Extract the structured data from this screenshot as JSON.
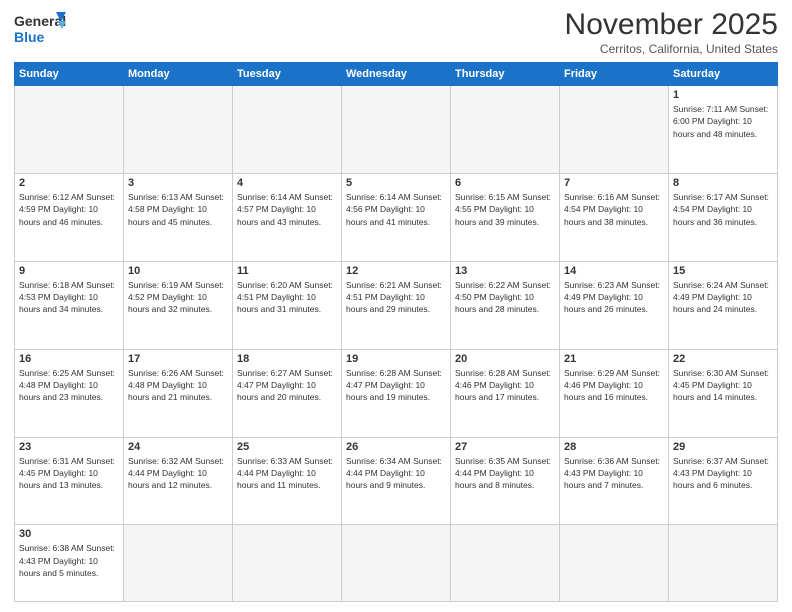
{
  "header": {
    "logo_general": "General",
    "logo_blue": "Blue",
    "month_title": "November 2025",
    "location": "Cerritos, California, United States"
  },
  "days_of_week": [
    "Sunday",
    "Monday",
    "Tuesday",
    "Wednesday",
    "Thursday",
    "Friday",
    "Saturday"
  ],
  "weeks": [
    [
      {
        "day": "",
        "info": ""
      },
      {
        "day": "",
        "info": ""
      },
      {
        "day": "",
        "info": ""
      },
      {
        "day": "",
        "info": ""
      },
      {
        "day": "",
        "info": ""
      },
      {
        "day": "",
        "info": ""
      },
      {
        "day": "1",
        "info": "Sunrise: 7:11 AM\nSunset: 6:00 PM\nDaylight: 10 hours and 48 minutes."
      }
    ],
    [
      {
        "day": "2",
        "info": "Sunrise: 6:12 AM\nSunset: 4:59 PM\nDaylight: 10 hours and 46 minutes."
      },
      {
        "day": "3",
        "info": "Sunrise: 6:13 AM\nSunset: 4:58 PM\nDaylight: 10 hours and 45 minutes."
      },
      {
        "day": "4",
        "info": "Sunrise: 6:14 AM\nSunset: 4:57 PM\nDaylight: 10 hours and 43 minutes."
      },
      {
        "day": "5",
        "info": "Sunrise: 6:14 AM\nSunset: 4:56 PM\nDaylight: 10 hours and 41 minutes."
      },
      {
        "day": "6",
        "info": "Sunrise: 6:15 AM\nSunset: 4:55 PM\nDaylight: 10 hours and 39 minutes."
      },
      {
        "day": "7",
        "info": "Sunrise: 6:16 AM\nSunset: 4:54 PM\nDaylight: 10 hours and 38 minutes."
      },
      {
        "day": "8",
        "info": "Sunrise: 6:17 AM\nSunset: 4:54 PM\nDaylight: 10 hours and 36 minutes."
      }
    ],
    [
      {
        "day": "9",
        "info": "Sunrise: 6:18 AM\nSunset: 4:53 PM\nDaylight: 10 hours and 34 minutes."
      },
      {
        "day": "10",
        "info": "Sunrise: 6:19 AM\nSunset: 4:52 PM\nDaylight: 10 hours and 32 minutes."
      },
      {
        "day": "11",
        "info": "Sunrise: 6:20 AM\nSunset: 4:51 PM\nDaylight: 10 hours and 31 minutes."
      },
      {
        "day": "12",
        "info": "Sunrise: 6:21 AM\nSunset: 4:51 PM\nDaylight: 10 hours and 29 minutes."
      },
      {
        "day": "13",
        "info": "Sunrise: 6:22 AM\nSunset: 4:50 PM\nDaylight: 10 hours and 28 minutes."
      },
      {
        "day": "14",
        "info": "Sunrise: 6:23 AM\nSunset: 4:49 PM\nDaylight: 10 hours and 26 minutes."
      },
      {
        "day": "15",
        "info": "Sunrise: 6:24 AM\nSunset: 4:49 PM\nDaylight: 10 hours and 24 minutes."
      }
    ],
    [
      {
        "day": "16",
        "info": "Sunrise: 6:25 AM\nSunset: 4:48 PM\nDaylight: 10 hours and 23 minutes."
      },
      {
        "day": "17",
        "info": "Sunrise: 6:26 AM\nSunset: 4:48 PM\nDaylight: 10 hours and 21 minutes."
      },
      {
        "day": "18",
        "info": "Sunrise: 6:27 AM\nSunset: 4:47 PM\nDaylight: 10 hours and 20 minutes."
      },
      {
        "day": "19",
        "info": "Sunrise: 6:28 AM\nSunset: 4:47 PM\nDaylight: 10 hours and 19 minutes."
      },
      {
        "day": "20",
        "info": "Sunrise: 6:28 AM\nSunset: 4:46 PM\nDaylight: 10 hours and 17 minutes."
      },
      {
        "day": "21",
        "info": "Sunrise: 6:29 AM\nSunset: 4:46 PM\nDaylight: 10 hours and 16 minutes."
      },
      {
        "day": "22",
        "info": "Sunrise: 6:30 AM\nSunset: 4:45 PM\nDaylight: 10 hours and 14 minutes."
      }
    ],
    [
      {
        "day": "23",
        "info": "Sunrise: 6:31 AM\nSunset: 4:45 PM\nDaylight: 10 hours and 13 minutes."
      },
      {
        "day": "24",
        "info": "Sunrise: 6:32 AM\nSunset: 4:44 PM\nDaylight: 10 hours and 12 minutes."
      },
      {
        "day": "25",
        "info": "Sunrise: 6:33 AM\nSunset: 4:44 PM\nDaylight: 10 hours and 11 minutes."
      },
      {
        "day": "26",
        "info": "Sunrise: 6:34 AM\nSunset: 4:44 PM\nDaylight: 10 hours and 9 minutes."
      },
      {
        "day": "27",
        "info": "Sunrise: 6:35 AM\nSunset: 4:44 PM\nDaylight: 10 hours and 8 minutes."
      },
      {
        "day": "28",
        "info": "Sunrise: 6:36 AM\nSunset: 4:43 PM\nDaylight: 10 hours and 7 minutes."
      },
      {
        "day": "29",
        "info": "Sunrise: 6:37 AM\nSunset: 4:43 PM\nDaylight: 10 hours and 6 minutes."
      }
    ],
    [
      {
        "day": "30",
        "info": "Sunrise: 6:38 AM\nSunset: 4:43 PM\nDaylight: 10 hours and 5 minutes."
      },
      {
        "day": "",
        "info": ""
      },
      {
        "day": "",
        "info": ""
      },
      {
        "day": "",
        "info": ""
      },
      {
        "day": "",
        "info": ""
      },
      {
        "day": "",
        "info": ""
      },
      {
        "day": "",
        "info": ""
      }
    ]
  ]
}
